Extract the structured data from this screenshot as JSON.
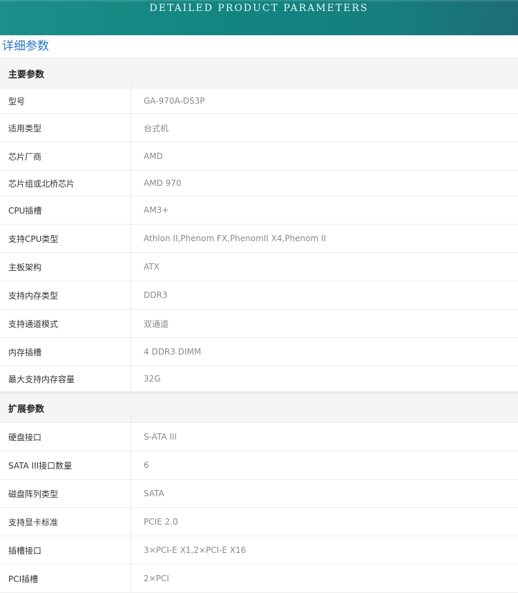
{
  "banner": {
    "title": "DETAILED PRODUCT PARAMETERS"
  },
  "section": {
    "heading": "详细参数"
  },
  "groups": [
    {
      "title": "主要参数",
      "rows": [
        {
          "label": "型号",
          "value": "GA-970A-DS3P"
        },
        {
          "label": "适用类型",
          "value": "台式机"
        },
        {
          "label": "芯片厂商",
          "value": "AMD"
        },
        {
          "label": "芯片组或北桥芯片",
          "value": "AMD 970"
        },
        {
          "label": "CPU插槽",
          "value": "AM3+"
        },
        {
          "label": "支持CPU类型",
          "value": "Athlon II,Phenom FX,PhenomII X4,Phenom II"
        },
        {
          "label": "主板架构",
          "value": "ATX"
        },
        {
          "label": "支持内存类型",
          "value": "DDR3"
        },
        {
          "label": "支持通道模式",
          "value": "双通道"
        },
        {
          "label": "内存插槽",
          "value": "4 DDR3 DIMM"
        },
        {
          "label": "最大支持内存容量",
          "value": "32G"
        }
      ]
    },
    {
      "title": "扩展参数",
      "rows": [
        {
          "label": "硬盘接口",
          "value": "S-ATA III"
        },
        {
          "label": "SATA III接口数量",
          "value": "6"
        },
        {
          "label": "磁盘阵列类型",
          "value": "SATA"
        },
        {
          "label": "支持显卡标准",
          "value": "PCIE 2.0"
        },
        {
          "label": "插槽接口",
          "value": "3×PCI-E X1,2×PCI-E X16"
        },
        {
          "label": "PCI插槽",
          "value": "2×PCI"
        }
      ]
    }
  ]
}
